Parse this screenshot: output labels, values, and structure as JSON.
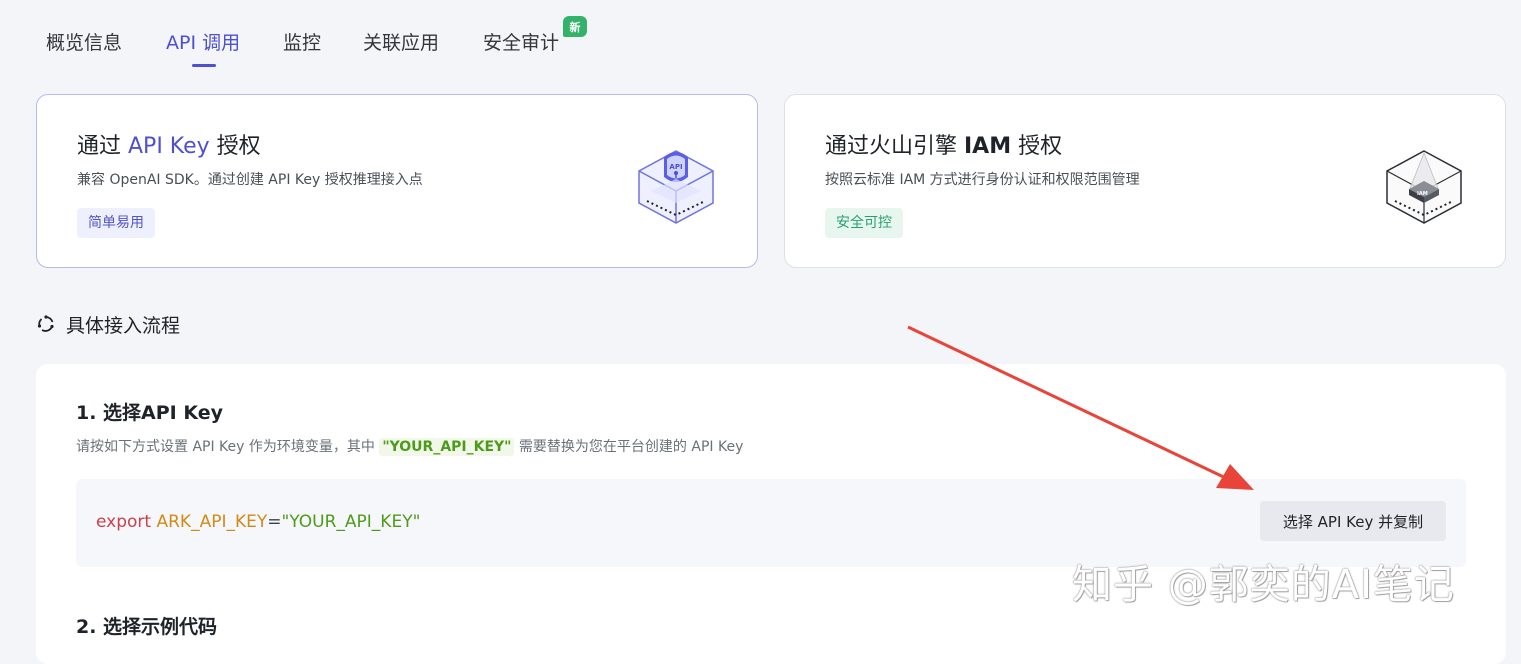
{
  "tabs": [
    {
      "label": "概览信息",
      "active": false
    },
    {
      "label": "API 调用",
      "active": true
    },
    {
      "label": "监控",
      "active": false
    },
    {
      "label": "关联应用",
      "active": false
    },
    {
      "label": "安全审计",
      "active": false,
      "badge": "新"
    }
  ],
  "cards": [
    {
      "title_prefix": "通过 ",
      "title_highlight": "API Key",
      "title_suffix": " 授权",
      "description": "兼容 OpenAI SDK。通过创建 API Key 授权推理接入点",
      "tag": "简单易用",
      "icon": "api-key-cube-icon",
      "selected": true
    },
    {
      "title_prefix": "通过火山引擎 ",
      "title_highlight": "IAM",
      "title_suffix": " 授权",
      "description": "按照云标准 IAM 方式进行身份认证和权限范围管理",
      "tag": "安全可控",
      "icon": "iam-cube-icon",
      "selected": false
    }
  ],
  "process": {
    "icon": "flow-cycle-icon",
    "title": "具体接入流程"
  },
  "steps": [
    {
      "title": "1. 选择API Key",
      "desc_before": "请按如下方式设置 API Key 作为环境变量，其中 ",
      "desc_key": "\"YOUR_API_KEY\"",
      "desc_after": " 需要替换为您在平台创建的 API Key",
      "code": {
        "keyword": "export",
        "variable": "ARK_API_KEY",
        "operator": "=",
        "value": "\"YOUR_API_KEY\""
      },
      "copy_button": "选择 API Key 并复制"
    },
    {
      "title": "2. 选择示例代码"
    }
  ],
  "watermark": "知乎 @郭奕的AI笔记",
  "colors": {
    "accent": "#4e4fd1",
    "annotation_arrow": "#e8443a",
    "badge_new": "#33b36a"
  }
}
